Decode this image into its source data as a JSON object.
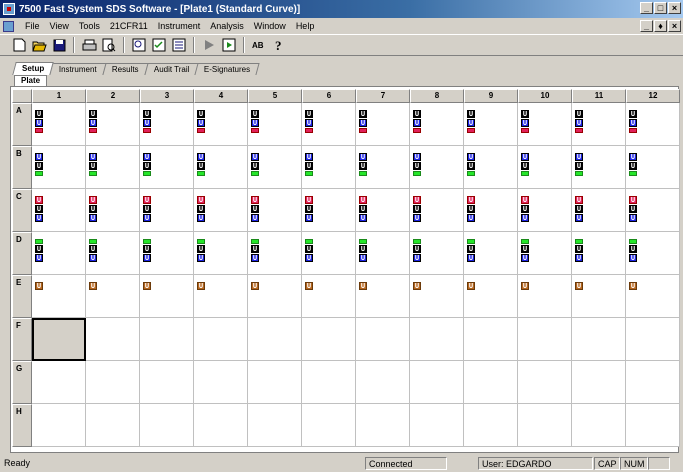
{
  "window": {
    "title": "7500 Fast System SDS Software - [Plate1 (Standard Curve)]",
    "buttons": [
      "_",
      "□",
      "×"
    ],
    "mdi_buttons": [
      "_",
      "♦",
      "×"
    ]
  },
  "menu": [
    "File",
    "View",
    "Tools",
    "21CFR11",
    "Instrument",
    "Analysis",
    "Window",
    "Help"
  ],
  "toolbar": {
    "icons": [
      "new-icon",
      "open-icon",
      "save-icon",
      "print-icon",
      "print-preview-icon",
      "zoom-icon",
      "checklist-icon",
      "form-icon",
      "play-icon",
      "run-icon",
      "spelling-icon",
      "help-icon"
    ]
  },
  "tabs": [
    "Setup",
    "Instrument",
    "Results",
    "Audit Trail",
    "E-Signatures"
  ],
  "active_tab": "Setup",
  "subtab": "Plate",
  "plate": {
    "columns": [
      "1",
      "2",
      "3",
      "4",
      "5",
      "6",
      "7",
      "8",
      "9",
      "10",
      "11",
      "12"
    ],
    "rows": [
      "A",
      "B",
      "C",
      "D",
      "E",
      "F",
      "G",
      "H"
    ],
    "well_marker": "U",
    "row_detectors": {
      "A": [
        "black",
        "blue",
        "red-small"
      ],
      "B": [
        "blue",
        "black",
        "green"
      ],
      "C": [
        "red",
        "black",
        "blue"
      ],
      "D": [
        "green",
        "black",
        "blue"
      ],
      "E": [
        "brown"
      ]
    },
    "row_detectors_col1": {
      "A": [
        "black",
        "blue",
        "red-small"
      ]
    },
    "selected_well": "F1"
  },
  "colors": {
    "black": "#000000",
    "blue": "#1b22e0",
    "green": "#25e62a",
    "red": "#e0205a",
    "brown": "#b5651d"
  },
  "status": {
    "left": "Ready",
    "connection": "Connected",
    "user": "User: EDGARDO",
    "cap": "CAP",
    "num": "NUM"
  }
}
